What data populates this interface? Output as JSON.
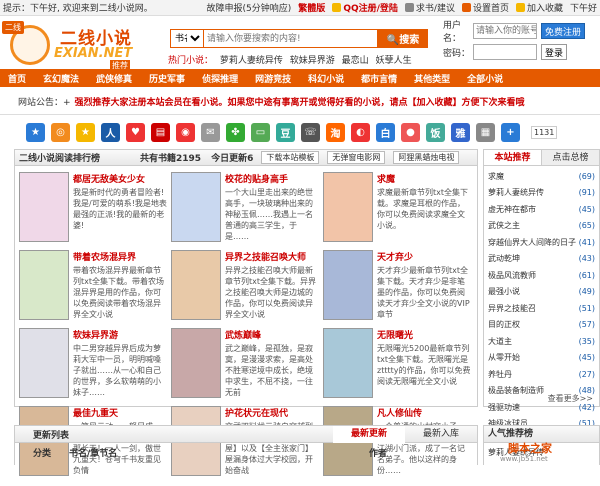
{
  "topbar": {
    "greeting": "提示：下午好, 欢迎来到二线小说网。",
    "links": [
      "故障申报(5分钟响应)",
      "繁體版",
      "QQ注册/登陆",
      "求书/建议",
      "设置首页",
      "加入收藏",
      "下午好"
    ]
  },
  "logo": {
    "badge": "二线",
    "main": "二线小说",
    "sub": "EXIAN.NET",
    "tag": "推荐"
  },
  "search": {
    "select": "书名",
    "placeholder": "请输入你要搜索的内容!",
    "button": "搜索"
  },
  "hot": {
    "label": "热门小说：",
    "items": [
      "萝莉人妻统异传",
      "软妹异界游",
      "最恋山",
      "妖孽人生"
    ]
  },
  "login": {
    "user_label": "用户名：",
    "user_placeholder": "请输入你的账号！",
    "user_btn": "免费注册",
    "pass_label": "密码：",
    "pass_btn": "登录"
  },
  "nav": [
    "首页",
    "玄幻魔法",
    "武侠修真",
    "历史军事",
    "侦探推理",
    "网游竞技",
    "科幻小说",
    "都市言情",
    "其他类型",
    "全部小说"
  ],
  "notice": {
    "label": "网站公告：+",
    "text": "强烈推荐大家注册本站会员在看小说。如果您中途有事离开或觉得好看的小说，请点【加入收藏】方便下次来看哦"
  },
  "share": {
    "count": "1131",
    "icons": [
      {
        "n": "star-share-icon",
        "c": "#2a7bd6",
        "g": "★"
      },
      {
        "n": "rss-share-icon",
        "c": "#f28b1e",
        "g": "◎"
      },
      {
        "n": "qzone-share-icon",
        "c": "#f5b800",
        "g": "★"
      },
      {
        "n": "renren-share-icon",
        "c": "#1a5ba7",
        "g": "人"
      },
      {
        "n": "love-share-icon",
        "c": "#e33",
        "g": "♥"
      },
      {
        "n": "book-share-icon",
        "c": "#c00",
        "g": "▤"
      },
      {
        "n": "weibo-share-icon",
        "c": "#e33",
        "g": "◉"
      },
      {
        "n": "mail-share-icon",
        "c": "#999",
        "g": "✉"
      },
      {
        "n": "clover-share-icon",
        "c": "#3a3",
        "g": "✤"
      },
      {
        "n": "message-share-icon",
        "c": "#5a5",
        "g": "▭"
      },
      {
        "n": "douban-share-icon",
        "c": "#3a9",
        "g": "豆"
      },
      {
        "n": "phone-share-icon",
        "c": "#555",
        "g": "☏"
      },
      {
        "n": "taobao-share-icon",
        "c": "#f60",
        "g": "淘"
      },
      {
        "n": "swirl-share-icon",
        "c": "#e33",
        "g": "◐"
      },
      {
        "n": "bai-share-icon",
        "c": "#2a7bd6",
        "g": "白"
      },
      {
        "n": "circle-share-icon",
        "c": "#e55",
        "g": "●"
      },
      {
        "n": "fan-share-icon",
        "c": "#4a9",
        "g": "饭"
      },
      {
        "n": "ya-share-icon",
        "c": "#36c",
        "g": "雅"
      },
      {
        "n": "chart-share-icon",
        "c": "#888",
        "g": "▦"
      },
      {
        "n": "plus-share-icon",
        "c": "#2a7bd6",
        "g": "+"
      }
    ]
  },
  "main": {
    "title": "二线小说阅读排行榜",
    "count": "共有书籍2195",
    "today": "今日更新6",
    "filters": [
      "下载本站模板",
      "无弹窗电影网",
      "阿狸黑蜡烛电视"
    ],
    "books": [
      {
        "title": "都居无敌美女少女",
        "desc": "我是新时代的勇者冒险者!我是/可爱的萌系!我是地表最强的正派!我的最新的老婆!",
        "color": "#f0d8e8"
      },
      {
        "title": "校花的贴身高手",
        "desc": "一个大山里走出来的绝世高手，一块玻璃种出来的神秘玉佩……我遇上一名普通的高三学生，于是……",
        "color": "#c9d8f0"
      },
      {
        "title": "求魔",
        "desc": "求魔最新章节列txt全集下载。求魔是耳根的作品，你可以免费阅读求魔全文小说。",
        "color": "#f2c4a8"
      },
      {
        "title": "带着农场混异界",
        "desc": "带着农场混异界最新章节列txt全集下载。带着农场混异界是用的作品，你可以免费阅读带着农场混异界全文小说",
        "color": "#d8e8c9"
      },
      {
        "title": "异界之技能召唤大师",
        "desc": "异界之技能召唤大师最新章节列txt全集下载。异界之技能召唤大师是边城的作品，你可以免费阅读异界全文小说",
        "color": "#e8c9a8"
      },
      {
        "title": "天才弃少",
        "desc": "天才弃少最新章节列txt全集下载。天才弃少是非笔墨的作品，你可以免费阅读天才弃少全文小说的VIP章节",
        "color": "#a8b8d8"
      },
      {
        "title": "软妹异界游",
        "desc": "中二男穿越异界后成为萝莉大军中一员，明明喊嗓子就出……从一心和自己的世界，多么软萌萌的小妹子……",
        "color": "#e0e0e8"
      },
      {
        "title": "武炼巅峰",
        "desc": "武之巅峰，是孤独，是寂寞，是漫漫求索，是高处不胜寒逆境中成长，绝境中求生，不屈不挠，一往无前",
        "color": "#c8a8a8"
      },
      {
        "title": "无限曙光",
        "desc": "无限曙光5200最新章节列txt全集下载。无限曙光是ztttty的作品，你可以免费阅读无限曙光全文小说",
        "color": "#a8c8d8"
      },
      {
        "title": "最佳九重天",
        "desc": "一笑风云动，一怒尸成河，一手便敲宇宙，一刹那长天！一人一剑，傲世九重天！苍穹千书友重见负情",
        "color": "#d8b898"
      },
      {
        "title": "护花状元在现代",
        "desc": "文武双料状元骑自穿越到现代都市，以【牛满小书屋】以及【全主张家门】屋漏身体过大学校园，开始奋战",
        "color": "#e8d0c0"
      },
      {
        "title": "凡人修仙传",
        "desc": "一个普通的山村穷小子，偶然之下，进入到当地的江湖小门派，成了一名记名弟子。他以这样的身份……",
        "color": "#b8a888"
      }
    ]
  },
  "side": {
    "tabs": [
      "本站推荐",
      "点击总榜"
    ],
    "more": "查看更多>>",
    "items": [
      {
        "n": "求魔",
        "r": "(69)"
      },
      {
        "n": "萝莉人妻统异传",
        "r": "(91)"
      },
      {
        "n": "虚无神在都市",
        "r": "(45)"
      },
      {
        "n": "武侠之主",
        "r": "(65)"
      },
      {
        "n": "穿越仙界大人间降的日子",
        "r": "(41)"
      },
      {
        "n": "武动乾坤",
        "r": "(43)"
      },
      {
        "n": "极品风流教师",
        "r": "(61)"
      },
      {
        "n": "最强小说",
        "r": "(49)"
      },
      {
        "n": "异界之技能召",
        "r": "(51)"
      },
      {
        "n": "目的正权",
        "r": "(57)"
      },
      {
        "n": "大道主",
        "r": "(35)"
      },
      {
        "n": "从零开始",
        "r": "(45)"
      },
      {
        "n": "养牡丹",
        "r": "(27)"
      },
      {
        "n": "极品装备制造师",
        "r": "(48)"
      },
      {
        "n": "强驱功速",
        "r": "(42)"
      },
      {
        "n": "神级冰球员",
        "r": "(51)"
      }
    ]
  },
  "updates": {
    "title": "更新列表",
    "tabs": [
      "最新更新",
      "最新入库"
    ],
    "cols": [
      "分类",
      "书名/章节名",
      "作者"
    ],
    "side_title": "人气推荐榜",
    "side_item": "萝莉人妻统异传"
  },
  "watermark": {
    "main": "脚本之家",
    "sub": "www.jb51.net"
  }
}
